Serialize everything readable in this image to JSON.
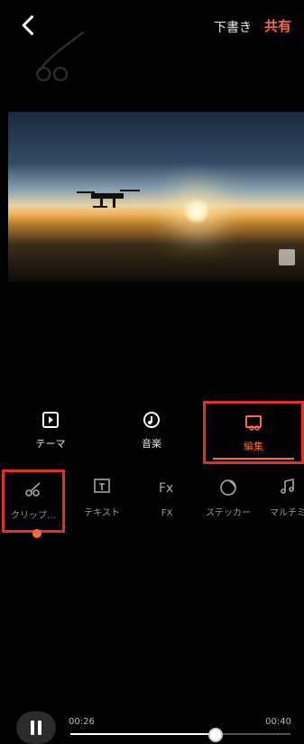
{
  "header": {
    "back_icon": "chevron-left-icon",
    "draft_label": "下書き",
    "share_label": "共有",
    "accent_color": "#ff6a3d"
  },
  "player": {
    "current_time": "00:26",
    "total_time": "00:40",
    "progress": 0.65
  },
  "tabs": [
    {
      "label": "テーマ",
      "icon": "theme-icon"
    },
    {
      "label": "音楽",
      "icon": "music-icon"
    },
    {
      "label": "編集",
      "icon": "edit-icon",
      "active": true
    }
  ],
  "tools": [
    {
      "label": "クリップ…",
      "icon": "scissors-icon",
      "selected": true
    },
    {
      "label": "テキスト",
      "icon": "text-icon"
    },
    {
      "label": "FX",
      "icon": "fx-icon"
    },
    {
      "label": "ステッカー",
      "icon": "sticker-icon"
    },
    {
      "label": "マルチミ",
      "icon": "music-note-icon"
    }
  ]
}
